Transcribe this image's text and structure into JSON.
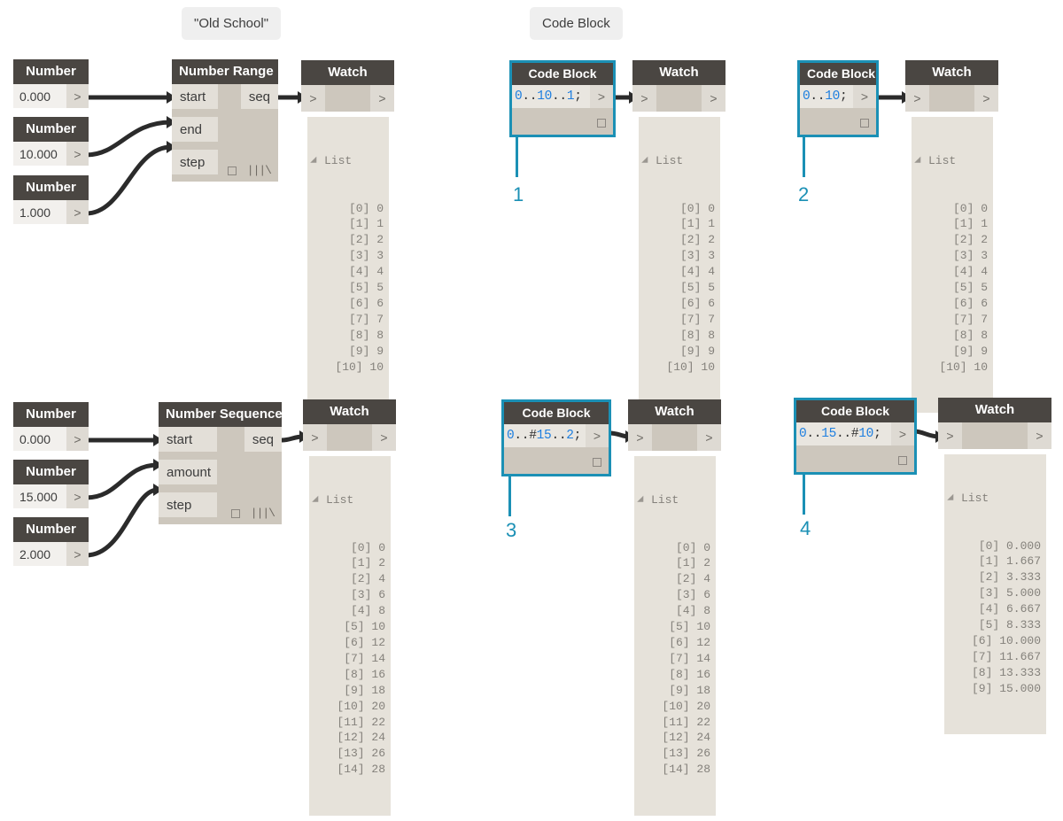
{
  "annotations": {
    "old_school": "\"Old School\"",
    "code_block": "Code Block"
  },
  "markers": {
    "m1": "1",
    "m2": "2",
    "m3": "3",
    "m4": "4"
  },
  "colors": {
    "accent": "#1b90b5",
    "node_header": "#4a4642",
    "node_body": "#cdc7bd",
    "port": "#e3dfd8",
    "code_number": "#1e7fe0"
  },
  "icons": {
    "port_arrow": ">",
    "lacing": "|||\\",
    "collapse_triangle": "▲"
  },
  "groups": {
    "range_old_school": {
      "numbers": [
        {
          "title": "Number",
          "value": "0.000",
          "out_port": ">"
        },
        {
          "title": "Number",
          "value": "10.000",
          "out_port": ">"
        },
        {
          "title": "Number",
          "value": "1.000",
          "out_port": ">"
        }
      ],
      "fn": {
        "title": "Number Range",
        "inputs": [
          "start",
          "end",
          "step"
        ],
        "output": "seq"
      },
      "watch": {
        "title": "Watch",
        "in_port": ">",
        "out_port": ">",
        "list_label": "List",
        "rows": [
          "[0] 0",
          "[1] 1",
          "[2] 2",
          "[3] 3",
          "[4] 4",
          "[5] 5",
          "[6] 6",
          "[7] 7",
          "[8] 8",
          "[9] 9",
          "[10] 10"
        ]
      }
    },
    "sequence_old_school": {
      "numbers": [
        {
          "title": "Number",
          "value": "0.000",
          "out_port": ">"
        },
        {
          "title": "Number",
          "value": "15.000",
          "out_port": ">"
        },
        {
          "title": "Number",
          "value": "2.000",
          "out_port": ">"
        }
      ],
      "fn": {
        "title": "Number Sequence",
        "inputs": [
          "start",
          "amount",
          "step"
        ],
        "output": "seq"
      },
      "watch": {
        "title": "Watch",
        "in_port": ">",
        "out_port": ">",
        "list_label": "List",
        "rows": [
          "[0] 0",
          "[1] 2",
          "[2] 4",
          "[3] 6",
          "[4] 8",
          "[5] 10",
          "[6] 12",
          "[7] 14",
          "[8] 16",
          "[9] 18",
          "[10] 20",
          "[11] 22",
          "[12] 24",
          "[13] 26",
          "[14] 28"
        ]
      }
    },
    "cb1": {
      "code_block": {
        "title": "Code Block",
        "code_tokens": [
          {
            "t": "0",
            "k": "n"
          },
          {
            "t": "..",
            "k": "p"
          },
          {
            "t": "10",
            "k": "n"
          },
          {
            "t": "..",
            "k": "p"
          },
          {
            "t": "1",
            "k": "n"
          },
          {
            "t": ";",
            "k": "p"
          }
        ],
        "code_text": "0..10..1;",
        "out_port": ">"
      },
      "watch": {
        "title": "Watch",
        "in_port": ">",
        "out_port": ">",
        "list_label": "List",
        "rows": [
          "[0] 0",
          "[1] 1",
          "[2] 2",
          "[3] 3",
          "[4] 4",
          "[5] 5",
          "[6] 6",
          "[7] 7",
          "[8] 8",
          "[9] 9",
          "[10] 10"
        ]
      }
    },
    "cb2": {
      "code_block": {
        "title": "Code Block",
        "code_tokens": [
          {
            "t": "0",
            "k": "n"
          },
          {
            "t": "..",
            "k": "p"
          },
          {
            "t": "10",
            "k": "n"
          },
          {
            "t": ";",
            "k": "p"
          }
        ],
        "code_text": "0..10;",
        "out_port": ">"
      },
      "watch": {
        "title": "Watch",
        "in_port": ">",
        "out_port": ">",
        "list_label": "List",
        "rows": [
          "[0] 0",
          "[1] 1",
          "[2] 2",
          "[3] 3",
          "[4] 4",
          "[5] 5",
          "[6] 6",
          "[7] 7",
          "[8] 8",
          "[9] 9",
          "[10] 10"
        ]
      }
    },
    "cb3": {
      "code_block": {
        "title": "Code Block",
        "code_tokens": [
          {
            "t": "0",
            "k": "n"
          },
          {
            "t": "..#",
            "k": "p"
          },
          {
            "t": "15",
            "k": "n"
          },
          {
            "t": "..",
            "k": "p"
          },
          {
            "t": "2",
            "k": "n"
          },
          {
            "t": ";",
            "k": "p"
          }
        ],
        "code_text": "0..#15..2;",
        "out_port": ">"
      },
      "watch": {
        "title": "Watch",
        "in_port": ">",
        "out_port": ">",
        "list_label": "List",
        "rows": [
          "[0] 0",
          "[1] 2",
          "[2] 4",
          "[3] 6",
          "[4] 8",
          "[5] 10",
          "[6] 12",
          "[7] 14",
          "[8] 16",
          "[9] 18",
          "[10] 20",
          "[11] 22",
          "[12] 24",
          "[13] 26",
          "[14] 28"
        ]
      }
    },
    "cb4": {
      "code_block": {
        "title": "Code Block",
        "code_tokens": [
          {
            "t": "0",
            "k": "n"
          },
          {
            "t": "..",
            "k": "p"
          },
          {
            "t": "15",
            "k": "n"
          },
          {
            "t": "..#",
            "k": "p"
          },
          {
            "t": "10",
            "k": "n"
          },
          {
            "t": ";",
            "k": "p"
          }
        ],
        "code_text": "0..15..#10;",
        "out_port": ">"
      },
      "watch": {
        "title": "Watch",
        "in_port": ">",
        "out_port": ">",
        "list_label": "List",
        "rows": [
          "[0] 0.000",
          "[1] 1.667",
          "[2] 3.333",
          "[3] 5.000",
          "[4] 6.667",
          "[5] 8.333",
          "[6] 10.000",
          "[7] 11.667",
          "[8] 13.333",
          "[9] 15.000"
        ]
      }
    }
  }
}
